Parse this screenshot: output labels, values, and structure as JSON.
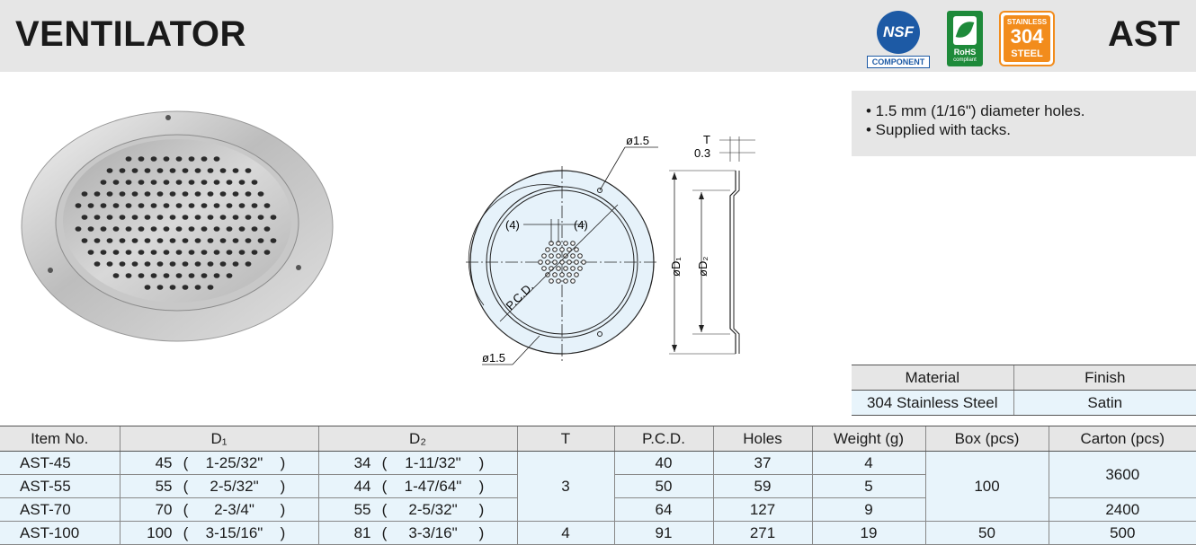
{
  "header": {
    "title": "VENTILATOR",
    "code": "AST",
    "badges": {
      "nsf_text": "NSF",
      "nsf_label": "COMPONENT",
      "rohs_text": "RoHS",
      "rohs_sub": "compliant",
      "steel_top": "STAINLESS",
      "steel_mid": "304",
      "steel_bot": "STEEL"
    }
  },
  "notes": [
    "• 1.5 mm (1/16\") diameter holes.",
    "• Supplied with tacks."
  ],
  "drawing": {
    "hole_dia_top": "ø1.5",
    "hole_dia_bottom": "ø1.5",
    "pitch_left": "(4)",
    "pitch_right": "(4)",
    "pcd": "P.C.D.",
    "t": "T",
    "t_value": "0.3",
    "d1": "øD₁",
    "d2": "øD₂"
  },
  "material_table": {
    "headers": [
      "Material",
      "Finish"
    ],
    "row": [
      "304 Stainless Steel",
      "Satin"
    ]
  },
  "spec_table": {
    "headers": [
      "Item No.",
      "D₁",
      "D₂",
      "T",
      "P.C.D.",
      "Holes",
      "Weight (g)",
      "Box (pcs)",
      "Carton (pcs)"
    ],
    "rows": [
      {
        "item": "AST-45",
        "d1": "45",
        "d1_in": "1-25/32\"",
        "d2": "34",
        "d2_in": "1-11/32\"",
        "pcd": "40",
        "holes": "37",
        "weight": "4"
      },
      {
        "item": "AST-55",
        "d1": "55",
        "d1_in": "2-5/32\"",
        "d2": "44",
        "d2_in": "1-47/64\"",
        "pcd": "50",
        "holes": "59",
        "weight": "5"
      },
      {
        "item": "AST-70",
        "d1": "70",
        "d1_in": "2-3/4\"",
        "d2": "55",
        "d2_in": "2-5/32\"",
        "pcd": "64",
        "holes": "127",
        "weight": "9"
      },
      {
        "item": "AST-100",
        "d1": "100",
        "d1_in": "3-15/16\"",
        "d2": "81",
        "d2_in": "3-3/16\"",
        "pcd": "91",
        "holes": "271",
        "weight": "19"
      }
    ],
    "t_group1": "3",
    "t_last": "4",
    "box_group1": "100",
    "box_last": "50",
    "carton_group1": "3600",
    "carton_row3": "2400",
    "carton_last": "500"
  },
  "colors": {
    "header_bg": "#e6e6e6",
    "cell_bg": "#e8f4fb",
    "nsf_blue": "#1d5aa5",
    "rohs_green": "#1e8a3a",
    "steel_orange": "#f28c1c"
  }
}
